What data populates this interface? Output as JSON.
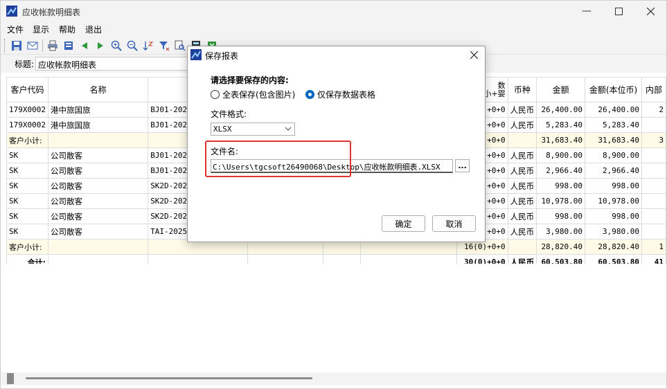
{
  "window": {
    "title": "应收帐款明细表"
  },
  "menu": [
    "文件",
    "显示",
    "帮助",
    "退出"
  ],
  "toolbar": {
    "icons": [
      "save-icon",
      "email-icon",
      "print-icon",
      "preview-icon",
      "prev-icon",
      "next-icon",
      "zoom-in-icon",
      "zoom-out-icon",
      "sort-icon",
      "filter-icon",
      "find-icon",
      "calculator-icon",
      "export-icon"
    ]
  },
  "report": {
    "title_label": "标题:",
    "title_value": "应收帐款明细表"
  },
  "grid": {
    "headers_left": [
      "客户代码",
      "名称",
      "",
      "",
      "",
      ""
    ],
    "headers_right": [
      "数\n小+婴",
      "币种",
      "金额",
      "金额(本位币)",
      "内部"
    ],
    "rows": [
      {
        "type": "data",
        "cells": [
          "179X0002",
          "港中旅国旅",
          "BJ01-20250",
          "",
          "",
          "",
          "+0+0",
          "人民币",
          "26,400.00",
          "26,400.00",
          "2"
        ]
      },
      {
        "type": "data",
        "cells": [
          "179X0002",
          "港中旅国旅",
          "BJ01-20250",
          "",
          "",
          "",
          "+0+0",
          "人民币",
          "5,283.40",
          "5,283.40",
          ""
        ]
      },
      {
        "type": "subtotal",
        "cells": [
          "客户小计:",
          "",
          "",
          "",
          "",
          "",
          "+0+0",
          "",
          "31,683.40",
          "31,683.40",
          "3"
        ]
      },
      {
        "type": "data",
        "cells": [
          "SK",
          "公司散客",
          "BJ01-20250",
          "",
          "",
          "",
          "+0+0",
          "人民币",
          "8,900.00",
          "8,900.00",
          ""
        ]
      },
      {
        "type": "data",
        "cells": [
          "SK",
          "公司散客",
          "BJ01-20250",
          "",
          "",
          "",
          "+0+0",
          "人民币",
          "2,966.40",
          "2,966.40",
          ""
        ]
      },
      {
        "type": "data",
        "cells": [
          "SK",
          "公司散客",
          "SK2D-20250",
          "",
          "",
          "",
          "+0+0",
          "人民币",
          "998.00",
          "998.00",
          ""
        ]
      },
      {
        "type": "data",
        "cells": [
          "SK",
          "公司散客",
          "SK2D-20250",
          "",
          "",
          "",
          "+0+0",
          "人民币",
          "10,978.00",
          "10,978.00",
          ""
        ]
      },
      {
        "type": "data",
        "cells": [
          "SK",
          "公司散客",
          "SK2D-20250",
          "",
          "",
          "",
          "+0+0",
          "人民币",
          "998.00",
          "998.00",
          ""
        ]
      },
      {
        "type": "data",
        "cells": [
          "SK",
          "公司散客",
          "TAI-202508",
          "",
          "",
          "",
          "+0+0",
          "人民币",
          "3,980.00",
          "3,980.00",
          ""
        ]
      },
      {
        "type": "subtotal",
        "cells": [
          "客户小计:",
          "",
          "",
          "",
          "",
          "",
          "16(0)+0+0",
          "",
          "28,820.40",
          "28,820.40",
          "1"
        ]
      },
      {
        "type": "total",
        "cells": [
          "合计:",
          "",
          "",
          "",
          "",
          "",
          "30(0)+0+0",
          "人民币",
          "60,503.80",
          "60,503.80",
          "41"
        ]
      }
    ]
  },
  "dialog": {
    "title": "保存报表",
    "section_label": "请选择要保存的内容:",
    "option_all": "全表保存(包含图片)",
    "option_data": "仅保存数据表格",
    "selected": "option_data",
    "format_label": "文件格式:",
    "format_value": "XLSX",
    "filename_label": "文件名:",
    "filename_value": "C:\\Users\\tgcsoft26490068\\Desktop\\应收帐款明细表.XLSX",
    "browse_label": "...",
    "ok_label": "确定",
    "cancel_label": "取消"
  },
  "colors": {
    "highlight": "#e0332c",
    "accent": "#0067c0",
    "subtotal_bg": "#fffbe8"
  }
}
